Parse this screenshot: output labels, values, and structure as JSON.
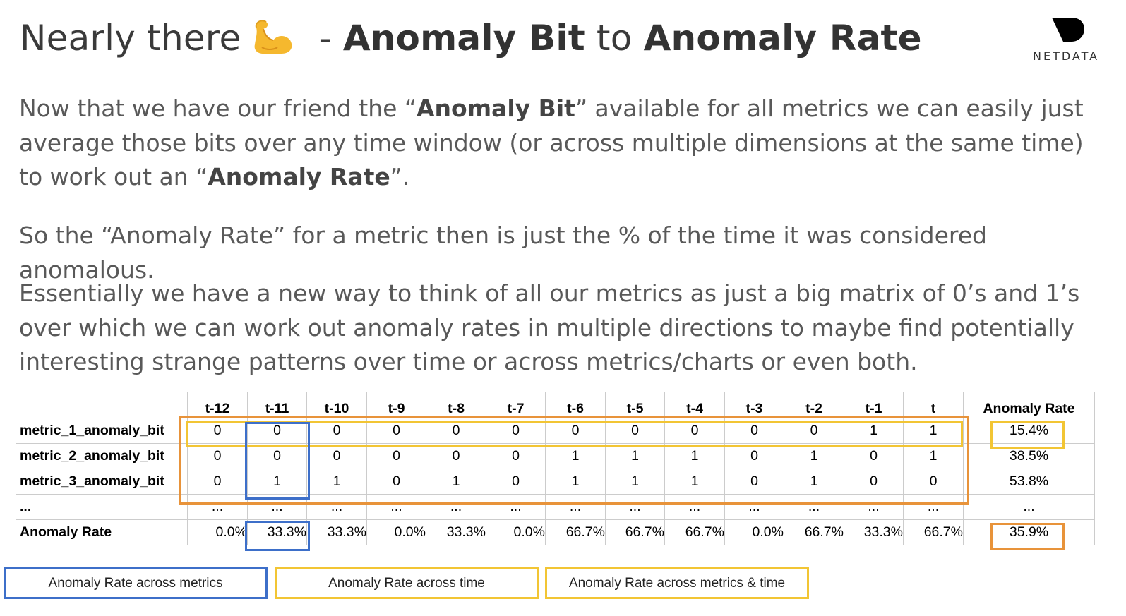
{
  "title": {
    "prefix": "Nearly there",
    "emoji_icon": "flexed-biceps-icon",
    "dash": " - ",
    "bold1": "Anomaly Bit",
    "middle": " to ",
    "bold2": "Anomaly Rate"
  },
  "logo": {
    "icon": "netdata-logo-icon",
    "text": "NETDATA"
  },
  "paragraphs": {
    "p1": {
      "part1": "Now that we have our friend the “",
      "bold1": "Anomaly Bit",
      "part2": "” available for all metrics we can easily just average those bits over any time window (or across multiple dimensions at the same time) to work out an “",
      "bold2": "Anomaly Rate",
      "part3": "”."
    },
    "p2": "So the “Anomaly Rate” for a metric then is just the % of the time it was considered anomalous.",
    "p3": "Essentially we have a new way to think of all our metrics as just a big matrix of 0’s and 1’s over which we can work out anomaly rates in multiple directions to maybe find potentially interesting strange patterns over time or across metrics/charts or even both."
  },
  "table": {
    "headers": [
      "",
      "t-12",
      "t-11",
      "t-10",
      "t-9",
      "t-8",
      "t-7",
      "t-6",
      "t-5",
      "t-4",
      "t-3",
      "t-2",
      "t-1",
      "t",
      "Anomaly Rate"
    ],
    "rows": [
      [
        "metric_1_anomaly_bit",
        "0",
        "0",
        "0",
        "0",
        "0",
        "0",
        "0",
        "0",
        "0",
        "0",
        "0",
        "1",
        "1",
        "15.4%"
      ],
      [
        "metric_2_anomaly_bit",
        "0",
        "0",
        "0",
        "0",
        "0",
        "0",
        "1",
        "1",
        "1",
        "0",
        "1",
        "0",
        "1",
        "38.5%"
      ],
      [
        "metric_3_anomaly_bit",
        "0",
        "1",
        "1",
        "0",
        "1",
        "0",
        "1",
        "1",
        "1",
        "0",
        "1",
        "0",
        "0",
        "53.8%"
      ],
      [
        "...",
        "...",
        "...",
        "...",
        "...",
        "...",
        "...",
        "...",
        "...",
        "...",
        "...",
        "...",
        "...",
        "...",
        "..."
      ],
      [
        "Anomaly Rate",
        "0.0%",
        "33.3%",
        "33.3%",
        "0.0%",
        "33.3%",
        "0.0%",
        "66.7%",
        "66.7%",
        "66.7%",
        "0.0%",
        "66.7%",
        "33.3%",
        "66.7%",
        "35.9%"
      ]
    ]
  },
  "legend": {
    "across_metrics": "Anomaly Rate across metrics",
    "across_time": "Anomaly Rate across time",
    "across_both": "Anomaly Rate across metrics & time"
  },
  "colors": {
    "across_metrics": "#3d6fc9",
    "across_time": "#f2c534",
    "across_both": "#e8933a"
  }
}
